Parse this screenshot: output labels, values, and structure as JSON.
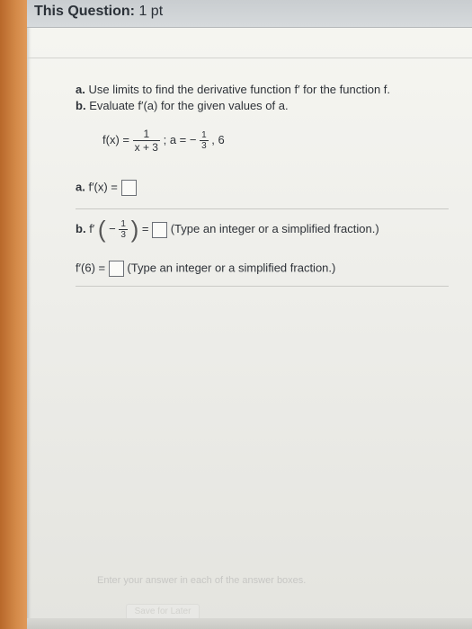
{
  "header": {
    "title": "This Question:",
    "points": "1 pt"
  },
  "instructions": {
    "a_letter": "a.",
    "a_text": "Use limits to find the derivative function f′ for the function f.",
    "b_letter": "b.",
    "b_text": "Evaluate f′(a) for the given values of a."
  },
  "function_def": {
    "lhs": "f(x) =",
    "numerator": "1",
    "denominator": "x + 3",
    "a_label": "; a = −",
    "a_frac_num": "1",
    "a_frac_den": "3",
    "a_rest": ", 6"
  },
  "part_a": {
    "label": "a.",
    "expr": "f′(x) ="
  },
  "part_b1": {
    "label": "b.",
    "fprime": "f′",
    "open_paren": "(",
    "minus": "−",
    "frac_num": "1",
    "frac_den": "3",
    "close_paren": ")",
    "equals": "=",
    "hint": "(Type an integer or a simplified fraction.)"
  },
  "part_b2": {
    "expr": "f′(6) =",
    "hint": "(Type an integer or a simplified fraction.)"
  },
  "footer": {
    "instruction": "Enter your answer in each of the answer boxes.",
    "button_label": "Save for Later"
  }
}
